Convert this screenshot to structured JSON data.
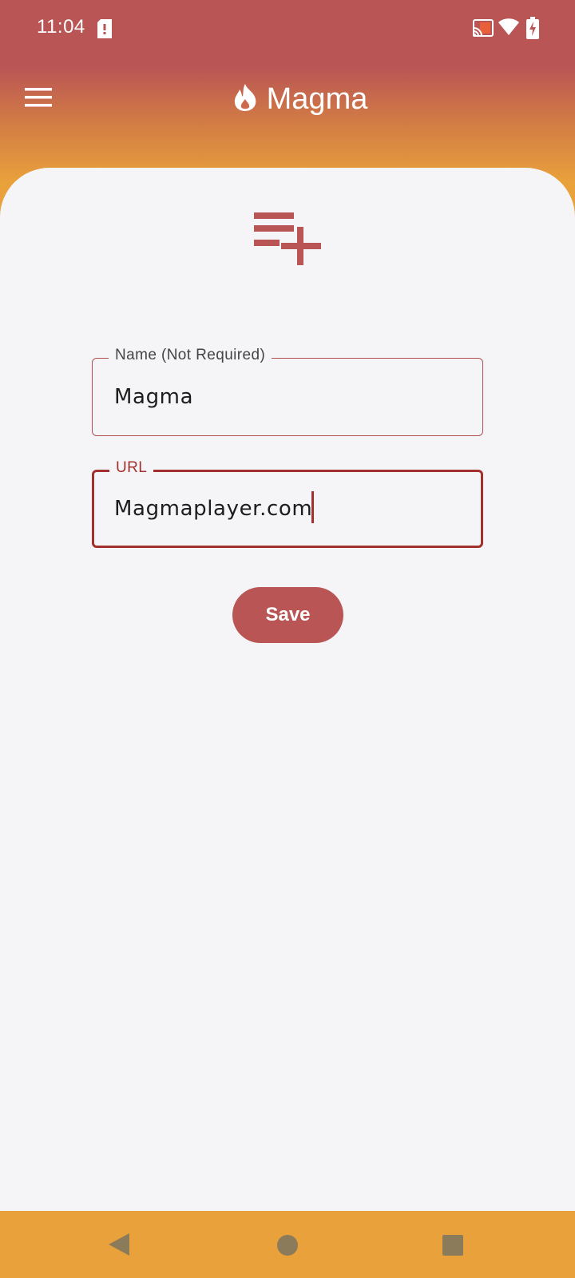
{
  "status_bar": {
    "time": "11:04",
    "icons": [
      "sim-card-icon",
      "cast-icon",
      "wifi-icon",
      "battery-charging-icon"
    ]
  },
  "app_bar": {
    "title": "Magma",
    "menu_icon": "hamburger-menu-icon",
    "logo_icon": "flame-icon"
  },
  "form": {
    "header_icon": "playlist-add-icon",
    "name_field": {
      "label": "Name (Not Required)",
      "value": "Magma"
    },
    "url_field": {
      "label": "URL",
      "value": "Magmaplayer.com"
    },
    "save_label": "Save"
  },
  "nav_bar": {
    "icons": [
      "back-icon",
      "home-icon",
      "recents-icon"
    ]
  },
  "colors": {
    "primary": "#ba5555",
    "primary_dark": "#a1302e",
    "accent": "#e9a23b",
    "background": "#f5f5f7"
  }
}
